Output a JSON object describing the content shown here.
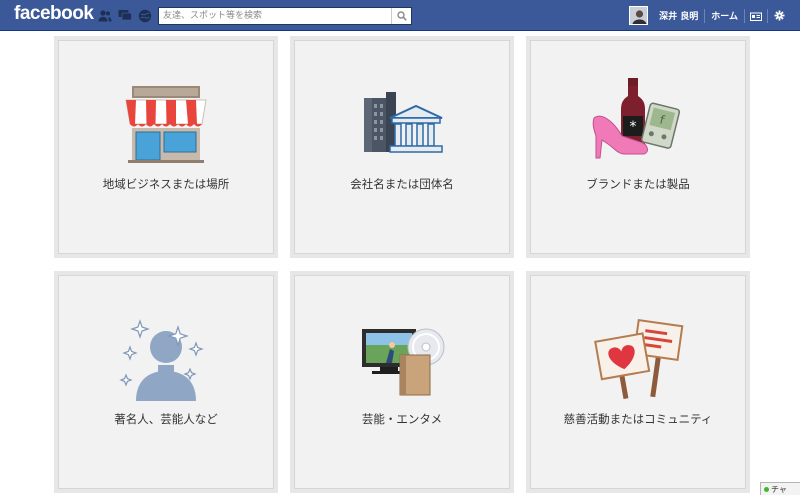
{
  "topbar": {
    "logo": "facebook",
    "search_placeholder": "友達、スポット等を検索",
    "user_name": "深井 良明",
    "home_label": "ホーム",
    "colors": {
      "bar": "#3b5998",
      "text": "#ffffff"
    },
    "icons": [
      "friend-requests-icon",
      "messages-icon",
      "notifications-icon",
      "search-icon",
      "privacy-shortcuts-icon",
      "settings-gear-icon"
    ]
  },
  "categories": [
    {
      "label": "地域ビジネスまたは場所",
      "icon": "storefront-icon"
    },
    {
      "label": "会社名または団体名",
      "icon": "company-buildings-icon"
    },
    {
      "label": "ブランドまたは製品",
      "icon": "brand-products-icon"
    },
    {
      "label": "著名人、芸能人など",
      "icon": "public-figure-icon"
    },
    {
      "label": "芸能・エンタメ",
      "icon": "entertainment-icon"
    },
    {
      "label": "慈善活動またはコミュニティ",
      "icon": "community-signs-icon"
    }
  ],
  "chat": {
    "label": "チャ"
  }
}
